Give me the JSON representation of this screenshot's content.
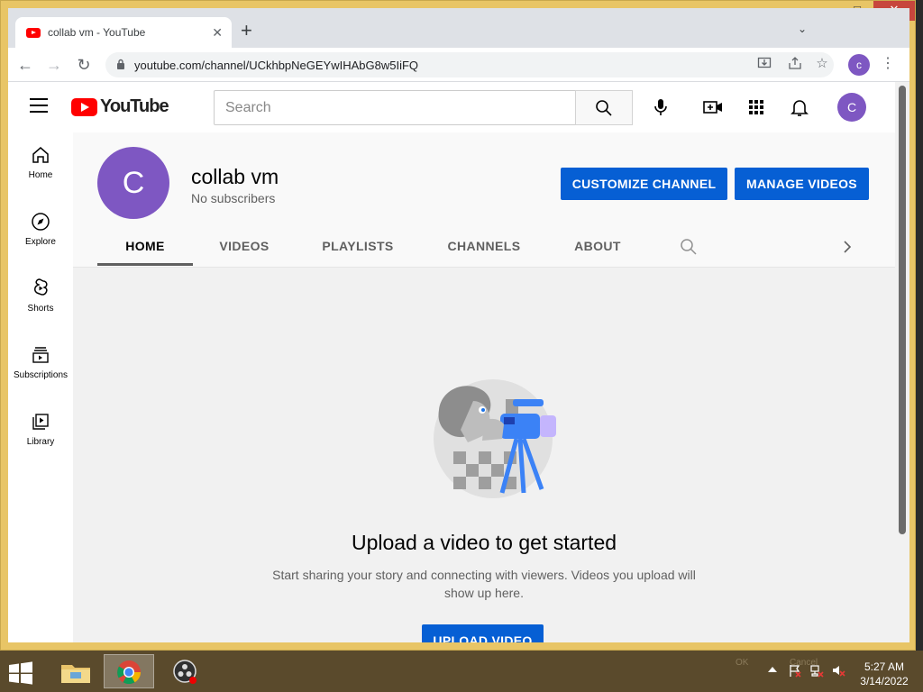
{
  "browser": {
    "tab_title": "collab vm - YouTube",
    "tab_close": "✕",
    "new_tab": "+",
    "tab_dropdown": "⌄",
    "url": "youtube.com/channel/UCkhbpNeGEYwIHAbG8w5IiFQ",
    "profile_initial": "c",
    "nav_icons": [
      "back-icon",
      "forward-icon",
      "reload-icon"
    ],
    "window_controls": [
      "minimize",
      "maximize",
      "close"
    ]
  },
  "youtube": {
    "logo_text": "YouTube",
    "search_placeholder": "Search",
    "avatar_initial": "C",
    "guide": [
      {
        "label": "Home",
        "icon": "home-icon"
      },
      {
        "label": "Explore",
        "icon": "compass-icon"
      },
      {
        "label": "Shorts",
        "icon": "shorts-icon"
      },
      {
        "label": "Subscriptions",
        "icon": "subscriptions-icon"
      },
      {
        "label": "Library",
        "icon": "library-icon"
      }
    ]
  },
  "channel": {
    "avatar_initial": "C",
    "name": "collab vm",
    "subscribers": "No subscribers",
    "customize_label": "CUSTOMIZE CHANNEL",
    "manage_label": "MANAGE VIDEOS",
    "tabs": [
      "HOME",
      "VIDEOS",
      "PLAYLISTS",
      "CHANNELS",
      "ABOUT"
    ],
    "active_tab": "HOME"
  },
  "empty_state": {
    "title": "Upload a video to get started",
    "body": "Start sharing your story and connecting with viewers. Videos you upload will show up here.",
    "upload_label": "UPLOAD VIDEO"
  },
  "taskbar": {
    "tray_ok": "OK",
    "tray_cancel": "Cancel",
    "time": "5:27 AM",
    "date": "3/14/2022"
  },
  "colors": {
    "window_frame": "#e8c566",
    "youtube_red": "#ff0000",
    "accent_blue": "#065fd4",
    "avatar_purple": "#7e57c2",
    "taskbar": "#5a4a2c"
  }
}
